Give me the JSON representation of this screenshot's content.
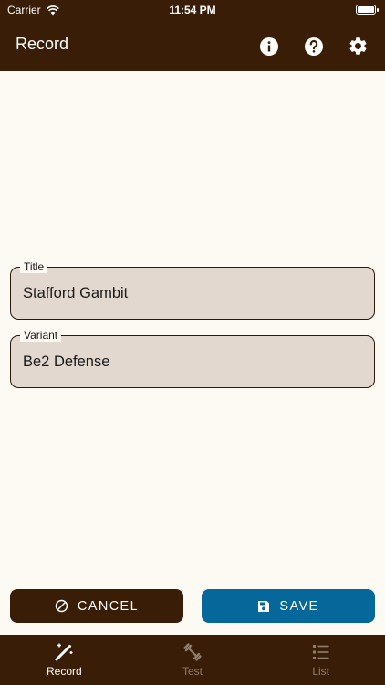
{
  "status_bar": {
    "carrier": "Carrier",
    "time": "11:54 PM"
  },
  "appbar": {
    "title": "Record",
    "actions": [
      {
        "icon": "info-icon"
      },
      {
        "icon": "help-icon"
      },
      {
        "icon": "gear-icon"
      }
    ]
  },
  "form": {
    "title": {
      "label": "Title",
      "value": "Stafford Gambit"
    },
    "variant": {
      "label": "Variant",
      "value": "Be2 Defense"
    }
  },
  "buttons": {
    "cancel_label": "CANCEL",
    "save_label": "SAVE"
  },
  "tabbar": {
    "tabs": [
      {
        "label": "Record",
        "icon": "magic-wand-icon",
        "active": true
      },
      {
        "label": "Test",
        "icon": "dumbbell-icon",
        "active": false
      },
      {
        "label": "List",
        "icon": "list-icon",
        "active": false
      }
    ]
  },
  "colors": {
    "brand_dark": "#3a1d06",
    "save_blue": "#05679a",
    "field_fill": "#e2d8cf",
    "background": "#fdf9f3"
  }
}
